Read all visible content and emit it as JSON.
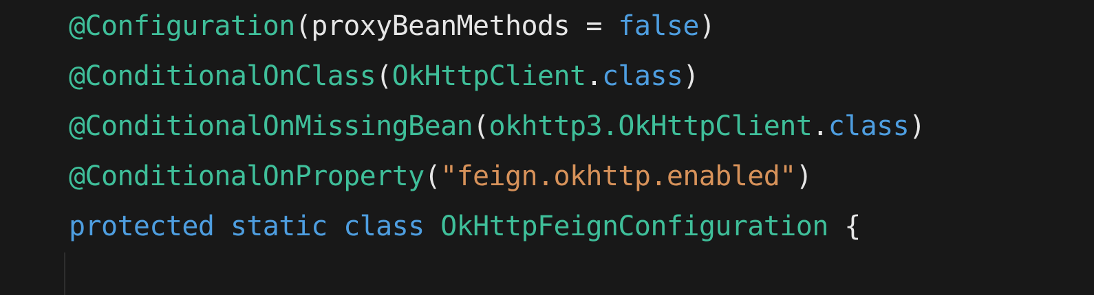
{
  "colors": {
    "background": "#181818",
    "annotation": "#3fbf9a",
    "keyword": "#4e9ee0",
    "string": "#d7925a",
    "plain": "#e6e6e6"
  },
  "code": {
    "line1": {
      "annotation": "@Configuration",
      "open": "(",
      "param": "proxyBeanMethods = ",
      "value": "false",
      "close": ")"
    },
    "line2": {
      "annotation": "@ConditionalOnClass",
      "open": "(",
      "type": "OkHttpClient",
      "dot": ".",
      "keyword": "class",
      "close": ")"
    },
    "line3": {
      "annotation": "@ConditionalOnMissingBean",
      "open": "(",
      "type": "okhttp3.OkHttpClient",
      "dot": ".",
      "keyword": "class",
      "close": ")"
    },
    "line4": {
      "annotation": "@ConditionalOnProperty",
      "open": "(",
      "string": "\"feign.okhttp.enabled\"",
      "close": ")"
    },
    "line5": {
      "kw1": "protected",
      "kw2": "static",
      "kw3": "class",
      "classname": "OkHttpFeignConfiguration",
      "brace": "{"
    }
  }
}
